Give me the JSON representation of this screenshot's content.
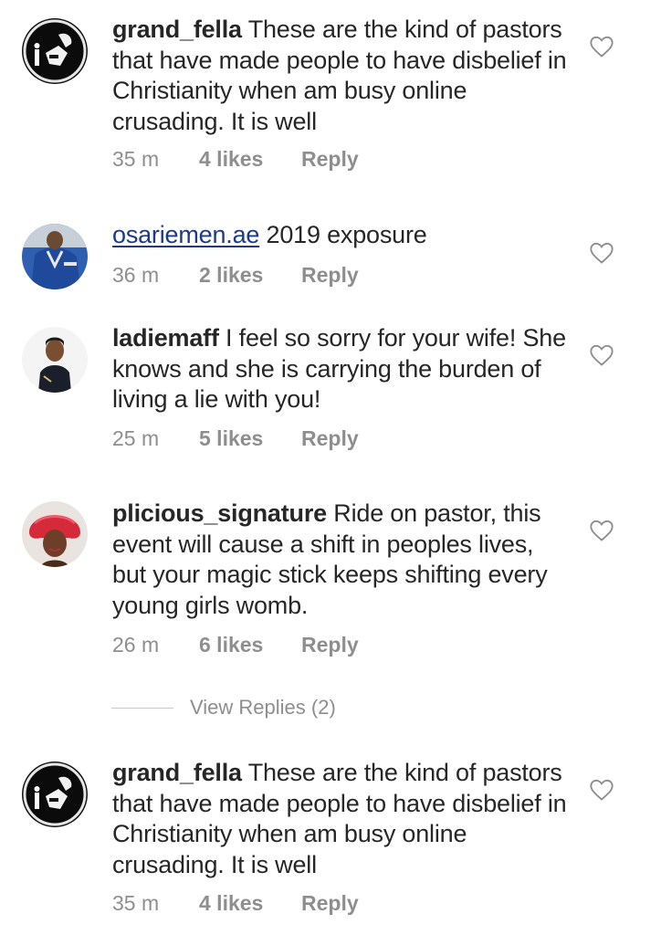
{
  "comments": [
    {
      "username": "grand_fella",
      "text": "These are the kind of pastors that have made people to have disbelief in Christianity when am busy online crusading. It is well",
      "time": "35 m",
      "likes": "4 likes",
      "reply": "Reply",
      "avatar_icon": "grand-fella-avatar"
    },
    {
      "username": "osariemen.ae",
      "text": "2019 exposure",
      "time": "36 m",
      "likes": "2 likes",
      "reply": "Reply",
      "avatar_icon": "osariemen-avatar"
    },
    {
      "username": "ladiemaff",
      "text": "I feel so sorry for your wife! She knows and she is carrying the burden of living a lie with you!",
      "time": "25 m",
      "likes": "5 likes",
      "reply": "Reply",
      "avatar_icon": "ladiemaff-avatar"
    },
    {
      "username": "plicious_signature",
      "text": "Ride on pastor, this event will cause a shift in peoples lives, but your magic stick keeps shifting every young girls womb.",
      "time": "26 m",
      "likes": "6 likes",
      "reply": "Reply",
      "avatar_icon": "plicious-avatar"
    },
    {
      "username": "grand_fella",
      "text": "These are the kind of pastors that have made people to have disbelief in Christianity when am busy online crusading. It is well",
      "time": "35 m",
      "likes": "4 likes",
      "reply": "Reply",
      "avatar_icon": "grand-fella-avatar"
    }
  ],
  "view_replies": "View Replies (2)",
  "colors": {
    "text": "#262626",
    "meta": "#8e8e8e",
    "link_username": "#1d3a8a",
    "heart_outline": "#8e8e8e"
  }
}
